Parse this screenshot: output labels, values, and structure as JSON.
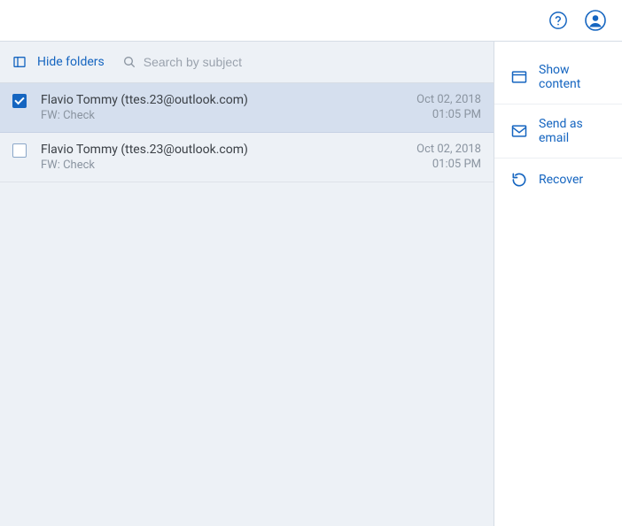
{
  "toolbar": {
    "hide_folders_label": "Hide folders",
    "search_placeholder": "Search by subject"
  },
  "messages": [
    {
      "selected": true,
      "from": "Flavio Tommy (ttes.23@outlook.com)",
      "subject": "FW: Check",
      "date": "Oct 02, 2018",
      "time": "01:05 PM"
    },
    {
      "selected": false,
      "from": "Flavio Tommy (ttes.23@outlook.com)",
      "subject": "FW: Check",
      "date": "Oct 02, 2018",
      "time": "01:05 PM"
    }
  ],
  "actions": {
    "show_content": "Show content",
    "send_as_email": "Send as email",
    "recover": "Recover"
  }
}
